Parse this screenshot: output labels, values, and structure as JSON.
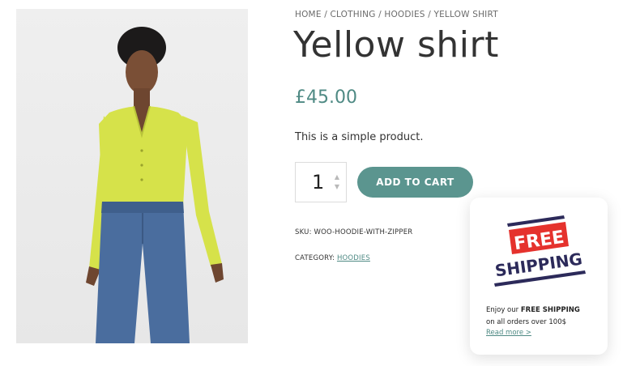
{
  "breadcrumb": "HOME / CLOTHING / HOODIES / YELLOW SHIRT",
  "product": {
    "title": "Yellow shirt",
    "price": "£45.00",
    "description": "This is a simple product.",
    "quantity": "1",
    "add_to_cart_label": "ADD TO CART",
    "sku_label": "SKU:",
    "sku": "WOO-HOODIE-WITH-ZIPPER",
    "category_label": "CATEGORY:",
    "category": "HOODIES"
  },
  "promo": {
    "badge_top": "FREE",
    "badge_bottom": "SHIPPING",
    "line1_prefix": "Enjoy our",
    "line1_bold": "FREE SHIPPING",
    "line2": "on all orders over 100$",
    "link": "Read more >"
  },
  "colors": {
    "accent": "#5b958f",
    "price": "#4f8a84",
    "shirt": "#d6e24a",
    "jeans": "#4a6d9e",
    "badge_red": "#e5322d",
    "badge_navy": "#2c2a5a"
  },
  "icons": {
    "qty_up": "chevron-up-icon",
    "qty_down": "chevron-down-icon"
  }
}
